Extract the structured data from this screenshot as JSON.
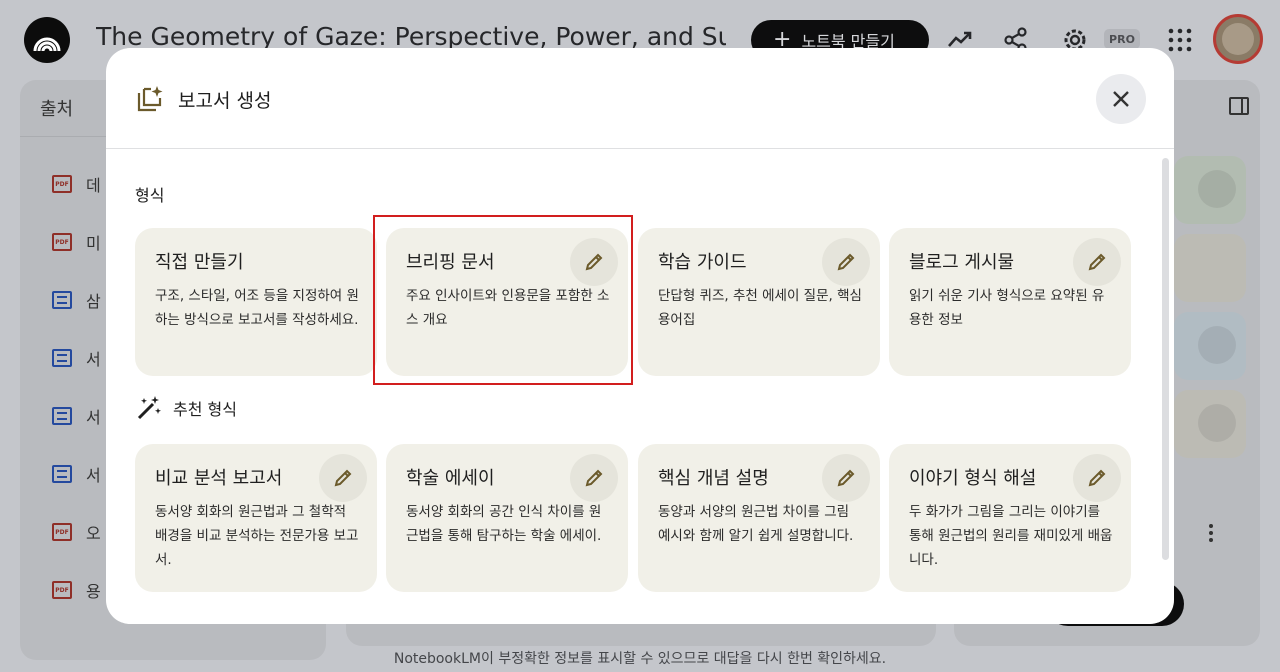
{
  "app": {
    "notebook_title": "The Geometry of Gaze: Perspective, Power, and Subj",
    "create_notebook_label": "노트북 만들기",
    "pro_badge": "PRO",
    "disclaimer": "NotebookLM이 부정확한 정보를 표시할 수 있으므로 대답을 다시 한번 확인하세요."
  },
  "sources_panel": {
    "title": "출처",
    "items": [
      {
        "icon": "pdf-icon",
        "label": "데"
      },
      {
        "icon": "pdf-icon",
        "label": "미"
      },
      {
        "icon": "web-icon",
        "label": "삼"
      },
      {
        "icon": "web-icon",
        "label": "서"
      },
      {
        "icon": "markdown-icon",
        "label": "서"
      },
      {
        "icon": "web-icon",
        "label": "서"
      },
      {
        "icon": "pdf-icon",
        "label": "오"
      },
      {
        "icon": "pdf-icon",
        "label": "용"
      }
    ]
  },
  "modal": {
    "title": "보고서 생성",
    "format_section": "형식",
    "recommended_section": "추천 형식",
    "formats": [
      {
        "title": "직접 만들기",
        "desc": "구조, 스타일, 어조 등을 지정하여 원하는 방식으로 보고서를 작성하세요.",
        "editable": false
      },
      {
        "title": "브리핑 문서",
        "desc": "주요 인사이트와 인용문을 포함한 소스 개요",
        "editable": true
      },
      {
        "title": "학습 가이드",
        "desc": "단답형 퀴즈, 추천 에세이 질문, 핵심 용어집",
        "editable": true
      },
      {
        "title": "블로그 게시물",
        "desc": "읽기 쉬운 기사 형식으로 요약된 유용한 정보",
        "editable": true
      }
    ],
    "recommended": [
      {
        "title": "비교 분석 보고서",
        "desc": "동서양 회화의 원근법과 그 철학적 배경을 비교 분석하는 전문가용 보고서."
      },
      {
        "title": "학술 에세이",
        "desc": "동서양 회화의 공간 인식 차이를 원근법을 통해 탐구하는 학술 에세이."
      },
      {
        "title": "핵심 개념 설명",
        "desc": "동양과 서양의 원근법 차이를 그림 예시와 함께 알기 쉽게 설명합니다."
      },
      {
        "title": "이야기 형식 해설",
        "desc": "두 화가가 그림을 그리는 이야기를 통해 원근법의 원리를 재미있게 배웁니다."
      }
    ]
  },
  "colors": {
    "card_bg": "#f1f0e8",
    "highlight": "#d21e1e",
    "overlay": "#c4c6cb"
  }
}
